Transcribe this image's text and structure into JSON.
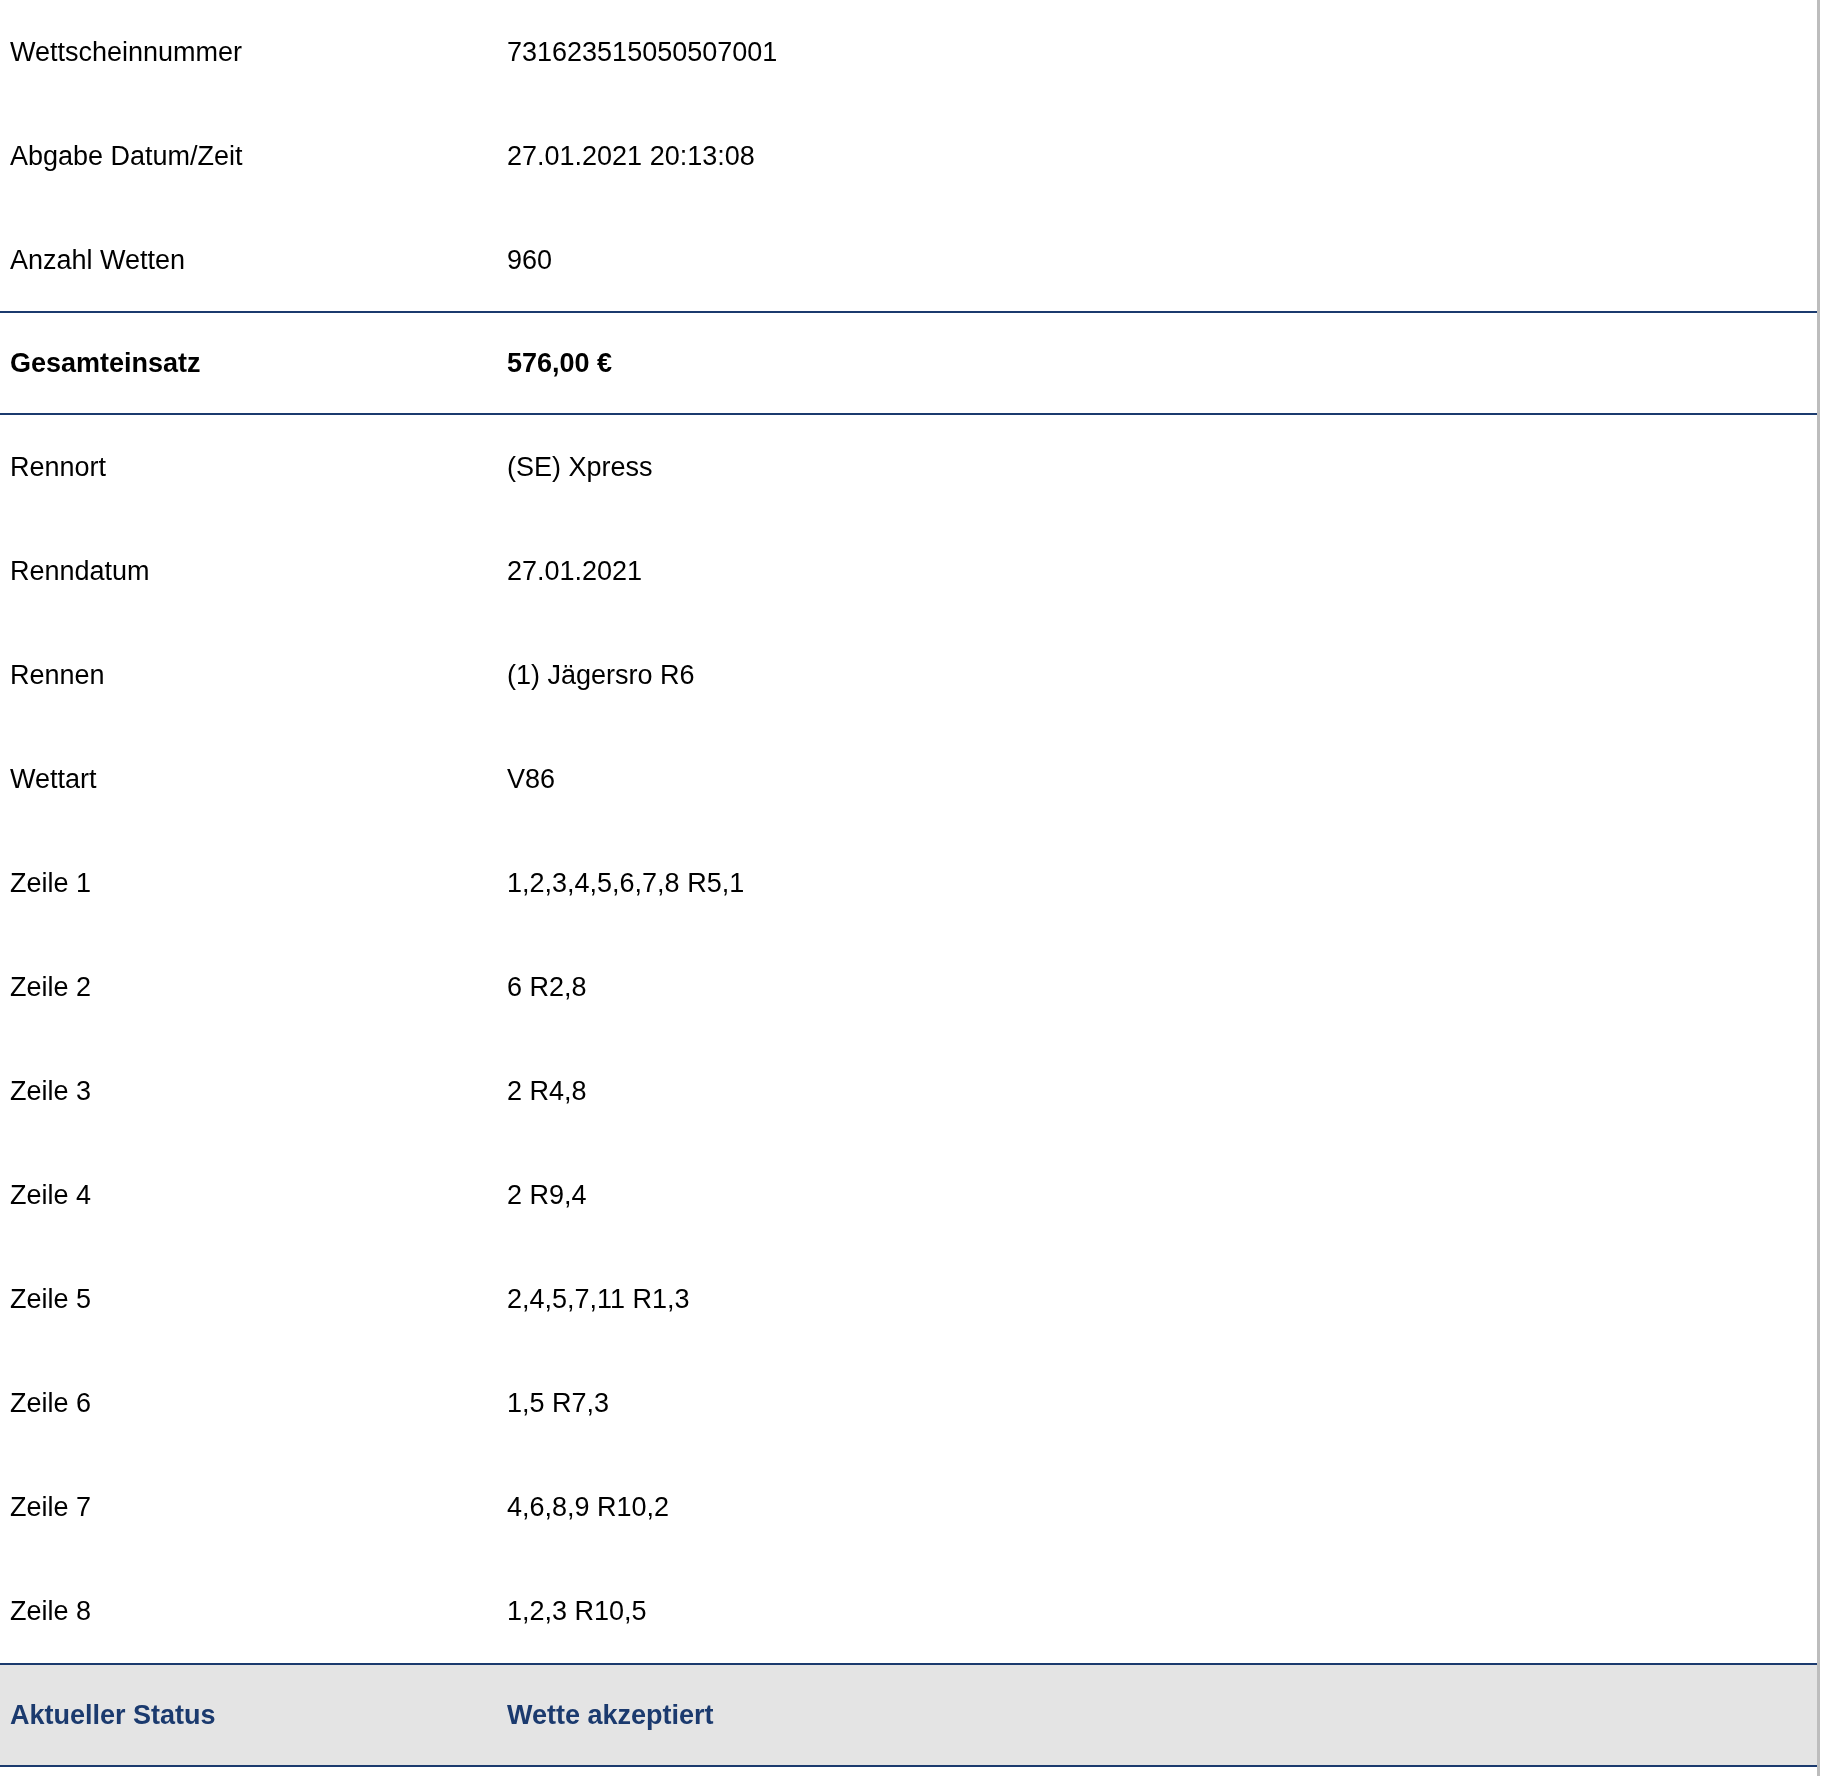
{
  "rows": [
    {
      "kind": "normal",
      "label": "Wettscheinnummer",
      "value": "731623515050507001"
    },
    {
      "kind": "normal",
      "label": "Abgabe Datum/Zeit",
      "value": "27.01.2021 20:13:08"
    },
    {
      "kind": "normal",
      "label": "Anzahl Wetten",
      "value": "960"
    },
    {
      "kind": "total",
      "label": "Gesamteinsatz",
      "value": "576,00 €"
    },
    {
      "kind": "normal",
      "label": "Rennort",
      "value": "(SE) Xpress"
    },
    {
      "kind": "normal",
      "label": "Renndatum",
      "value": "27.01.2021"
    },
    {
      "kind": "normal",
      "label": "Rennen",
      "value": "(1) Jägersro R6"
    },
    {
      "kind": "normal",
      "label": "Wettart",
      "value": "V86"
    },
    {
      "kind": "normal",
      "label": "Zeile 1",
      "value": "1,2,3,4,5,6,7,8 R5,1"
    },
    {
      "kind": "normal",
      "label": "Zeile 2",
      "value": "6 R2,8"
    },
    {
      "kind": "normal",
      "label": "Zeile 3",
      "value": "2 R4,8"
    },
    {
      "kind": "normal",
      "label": "Zeile 4",
      "value": "2 R9,4"
    },
    {
      "kind": "normal",
      "label": "Zeile 5",
      "value": "2,4,5,7,11 R1,3"
    },
    {
      "kind": "normal",
      "label": "Zeile 6",
      "value": "1,5 R7,3"
    },
    {
      "kind": "normal",
      "label": "Zeile 7",
      "value": "4,6,8,9 R10,2"
    },
    {
      "kind": "normal",
      "label": "Zeile 8",
      "value": "1,2,3 R10,5"
    },
    {
      "kind": "status",
      "label": "Aktueller Status",
      "value": "Wette akzeptiert"
    }
  ]
}
